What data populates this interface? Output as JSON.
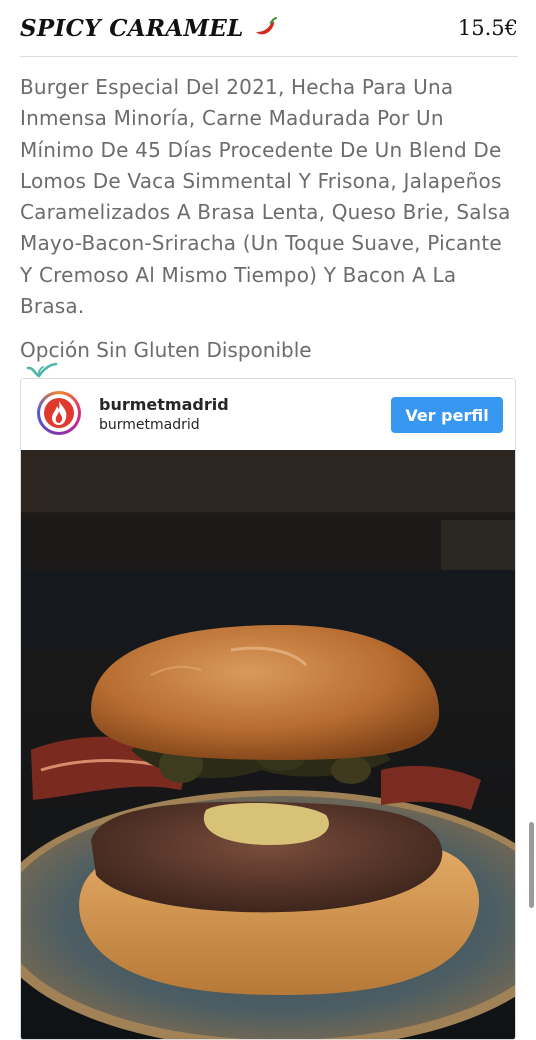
{
  "item": {
    "title": "SPICY CARAMEL",
    "price": "15.5€",
    "description": "Burger Especial Del 2021, Hecha Para Una Inmensa Minoría, Carne Madurada Por Un Mínimo De 45 Días Procedente De Un Blend De Lomos De Vaca Simmental Y Frisona, Jalapeños Caramelizados A Brasa Lenta, Queso Brie, Salsa Mayo-Bacon-Sriracha (Un Toque Suave, Picante Y Cremoso Al Mismo Tiempo) Y Bacon A La Brasa.",
    "gluten_free": "Opción Sin Gluten Disponible"
  },
  "instagram": {
    "username": "burmetmadrid",
    "handle": "burmetmadrid",
    "button_label": "Ver perfil",
    "button_color": "#3897f0"
  },
  "icons": {
    "title_icon": "chili-pepper-icon",
    "gluten_mark": "check-mark-icon",
    "avatar_logo": "flame-logo-icon"
  }
}
